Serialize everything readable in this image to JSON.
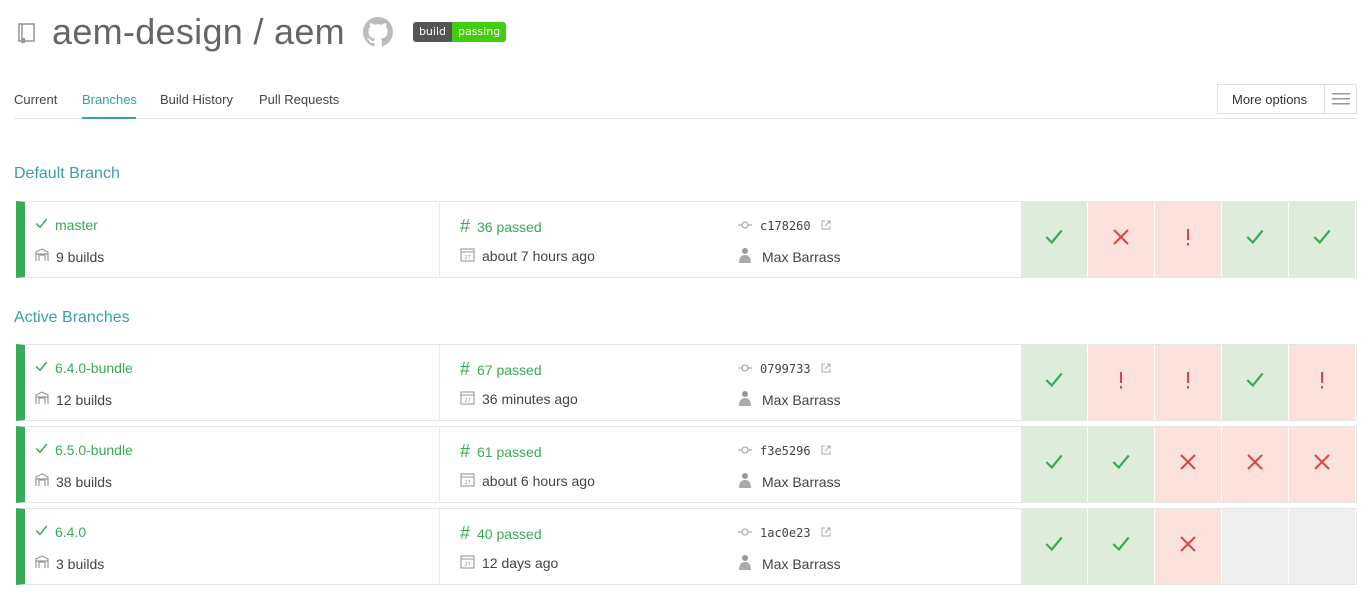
{
  "repo": {
    "title": "aem-design / aem",
    "badge_left": "build",
    "badge_right": "passing"
  },
  "icons": {
    "repo": "repo-icon",
    "github": "github-icon",
    "menu": "hamburger-icon"
  },
  "tabs": [
    {
      "label": "Current"
    },
    {
      "label": "Branches"
    },
    {
      "label": "Build History"
    },
    {
      "label": "Pull Requests"
    }
  ],
  "more_options": "More options",
  "sections": {
    "default": "Default Branch",
    "active": "Active Branches"
  },
  "colors": {
    "accent": "#39a0a8",
    "passed": "#39aa56",
    "failed": "#db4545"
  },
  "branches": [
    {
      "name": "master",
      "builds": "9 builds",
      "passed": "36 passed",
      "ago": "about 7 hours ago",
      "commit": "c178260",
      "author": "Max Barrass",
      "history": [
        "passed",
        "failed",
        "errored",
        "passed",
        "passed"
      ]
    },
    {
      "name": "6.4.0-bundle",
      "builds": "12 builds",
      "passed": "67 passed",
      "ago": "36 minutes ago",
      "commit": "0799733",
      "author": "Max Barrass",
      "history": [
        "passed",
        "errored",
        "errored",
        "passed",
        "errored"
      ]
    },
    {
      "name": "6.5.0-bundle",
      "builds": "38 builds",
      "passed": "61 passed",
      "ago": "about 6 hours ago",
      "commit": "f3e5296",
      "author": "Max Barrass",
      "history": [
        "passed",
        "passed",
        "failed",
        "failed",
        "failed"
      ]
    },
    {
      "name": "6.4.0",
      "builds": "3 builds",
      "passed": "40 passed",
      "ago": "12 days ago",
      "commit": "1ac0e23",
      "author": "Max Barrass",
      "history": [
        "passed",
        "passed",
        "failed",
        "none",
        "none"
      ]
    }
  ]
}
